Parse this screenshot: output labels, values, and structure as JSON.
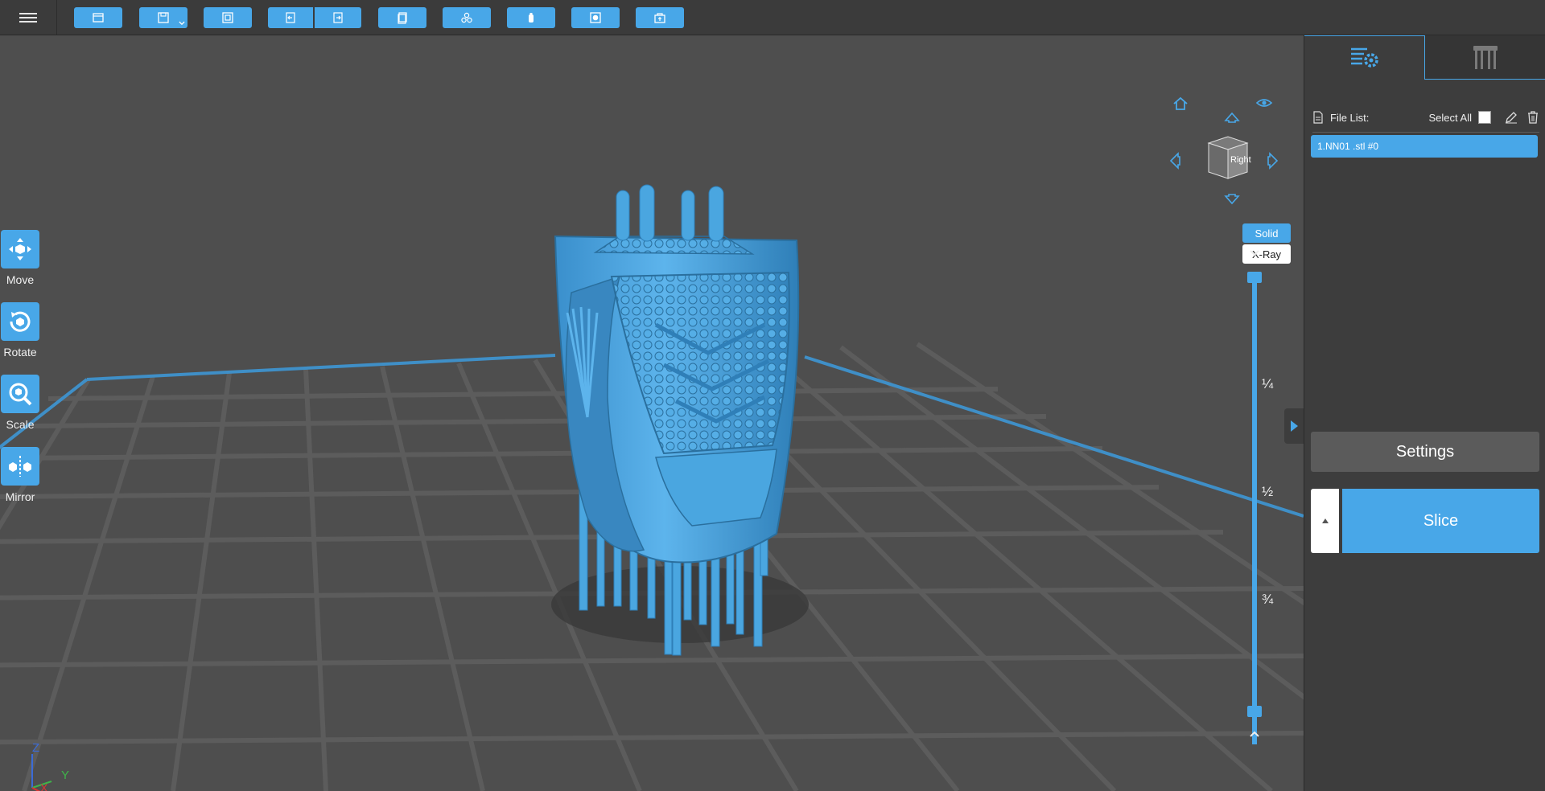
{
  "toolbar": {
    "buttons": [
      {
        "icon": "open-file-icon"
      },
      {
        "icon": "save-icon",
        "has_dropdown": true
      },
      {
        "icon": "import-icon"
      },
      {
        "icon": "undo-icon"
      },
      {
        "icon": "redo-icon"
      },
      {
        "icon": "copy-icon"
      },
      {
        "icon": "arrange-icon"
      },
      {
        "icon": "hollow-icon"
      },
      {
        "icon": "drain-hole-icon"
      },
      {
        "icon": "support-icon"
      }
    ]
  },
  "tools": [
    {
      "label": "Move",
      "icon": "move-icon"
    },
    {
      "label": "Rotate",
      "icon": "rotate-icon"
    },
    {
      "label": "Scale",
      "icon": "scale-icon"
    },
    {
      "label": "Mirror",
      "icon": "mirror-icon"
    }
  ],
  "view": {
    "cube_face": "Right",
    "modes": {
      "solid": "Solid",
      "xray": "X-Ray"
    },
    "active_mode": "Solid",
    "fractions": [
      "¼",
      "½",
      "¾"
    ],
    "axes": {
      "z": "Z",
      "y": "Y",
      "x": "X"
    }
  },
  "panel": {
    "file_list_label": "File List:",
    "select_all_label": "Select All",
    "files": [
      "1.NN01 .stl #0"
    ],
    "settings_label": "Settings",
    "slice_label": "Slice"
  },
  "colors": {
    "accent": "#48a7e8",
    "toolbar_bg": "#3b3b3b",
    "viewport_bg": "#4e4e4e",
    "panel_bg": "#3d3d3d",
    "model": "#4aa6e0"
  }
}
